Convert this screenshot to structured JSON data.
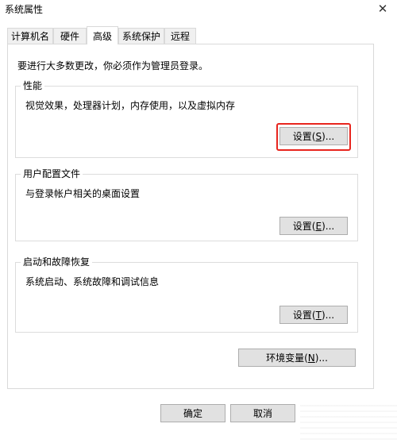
{
  "window": {
    "title": "系统属性"
  },
  "tabs": [
    {
      "label": "计算机名"
    },
    {
      "label": "硬件"
    },
    {
      "label": "高级",
      "active": true
    },
    {
      "label": "系统保护"
    },
    {
      "label": "远程"
    }
  ],
  "admin_note": "要进行大多数更改，你必须作为管理员登录。",
  "performance": {
    "title": "性能",
    "description": "视觉效果，处理器计划，内存使用，以及虚拟内存",
    "button": {
      "text": "设置(",
      "key": "S",
      "end": ")..."
    }
  },
  "user_profiles": {
    "title": "用户配置文件",
    "description": "与登录帐户相关的桌面设置",
    "button": {
      "text": "设置(",
      "key": "E",
      "end": ")..."
    }
  },
  "startup_recovery": {
    "title": "启动和故障恢复",
    "description": "系统启动、系统故障和调试信息",
    "button": {
      "text": "设置(",
      "key": "T",
      "end": ")..."
    }
  },
  "env_button": {
    "text": "环境变量(",
    "key": "N",
    "end": ")..."
  },
  "footer": {
    "ok": "确定",
    "cancel": "取消"
  },
  "colors": {
    "highlight": "#e8251e",
    "button_face": "#e1e1e1"
  },
  "icons": {
    "close": "close-icon"
  }
}
